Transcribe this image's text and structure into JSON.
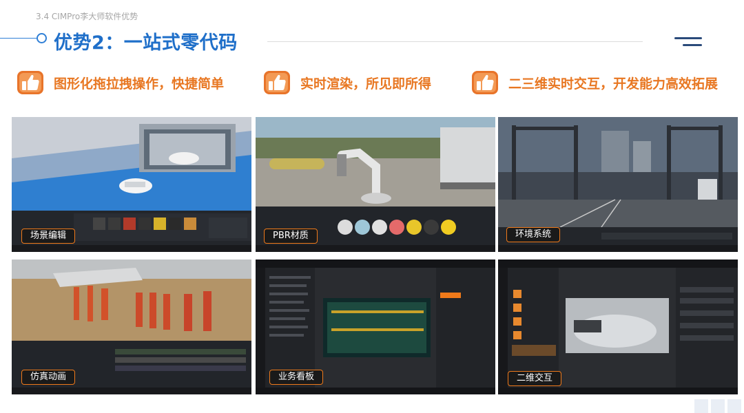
{
  "header": {
    "section_label": "3.4 CIMPro李大师软件优势",
    "title": "优势2：一站式零代码"
  },
  "features": [
    {
      "icon": "thumbs-up-icon",
      "text": "图形化拖拉拽操作，快捷简单"
    },
    {
      "icon": "thumbs-up-icon",
      "text": "实时渲染，所见即所得"
    },
    {
      "icon": "thumbs-up-icon",
      "text": "二三维实时交互，开发能力高效拓展"
    }
  ],
  "screenshots": [
    {
      "caption": "场景编辑"
    },
    {
      "caption": "PBR材质"
    },
    {
      "caption": "环境系统"
    },
    {
      "caption": "仿真动画"
    },
    {
      "caption": "业务看板"
    },
    {
      "caption": "二维交互"
    }
  ],
  "colors": {
    "title_blue": "#1f6fc9",
    "accent_orange": "#e87722",
    "caption_border": "#f07a1a"
  }
}
